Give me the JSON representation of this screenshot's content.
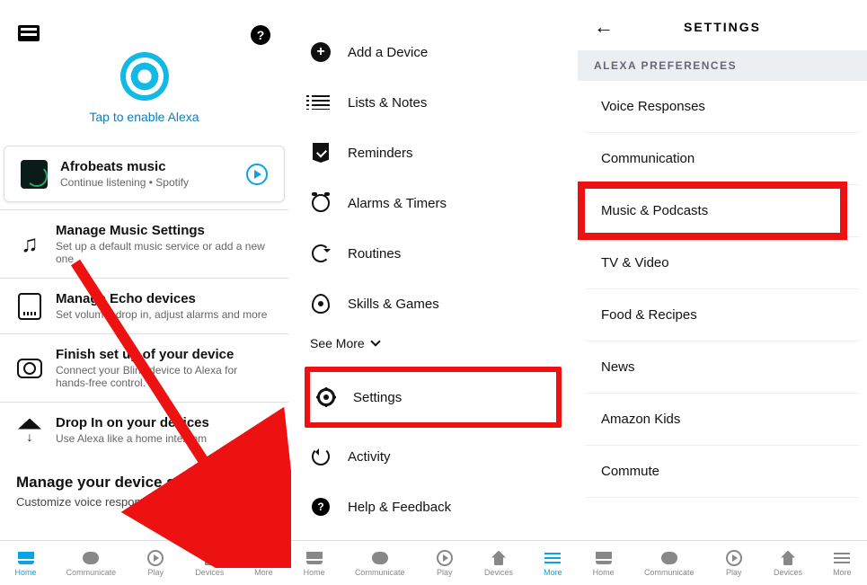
{
  "pane1": {
    "tap_enable": "Tap to enable Alexa",
    "cards": [
      {
        "title": "Afrobeats music",
        "sub": "Continue listening • Spotify"
      },
      {
        "title": "Manage Music Settings",
        "sub": "Set up a default music service or add a new one"
      },
      {
        "title": "Manage Echo devices",
        "sub": "Set volume, drop in, adjust alarms and more"
      },
      {
        "title": "Finish set up of your device",
        "sub": "Connect your Blink device to Alexa for hands-free control."
      },
      {
        "title": "Drop In on your devices",
        "sub": "Use Alexa like a home intercom"
      }
    ],
    "section_title": "Manage your device settings",
    "section_sub": "Customize voice responses, adjust"
  },
  "pane2": {
    "items": [
      "Add a Device",
      "Lists & Notes",
      "Reminders",
      "Alarms & Timers",
      "Routines",
      "Skills & Games"
    ],
    "see_more": "See More",
    "lower": [
      "Settings",
      "Activity",
      "Help & Feedback"
    ]
  },
  "pane3": {
    "title": "SETTINGS",
    "section": "ALEXA PREFERENCES",
    "items": [
      "Voice Responses",
      "Communication",
      "Music & Podcasts",
      "TV & Video",
      "Food & Recipes",
      "News",
      "Amazon Kids",
      "Commute"
    ]
  },
  "nav": {
    "home": "Home",
    "communicate": "Communicate",
    "play": "Play",
    "devices": "Devices",
    "more": "More"
  }
}
